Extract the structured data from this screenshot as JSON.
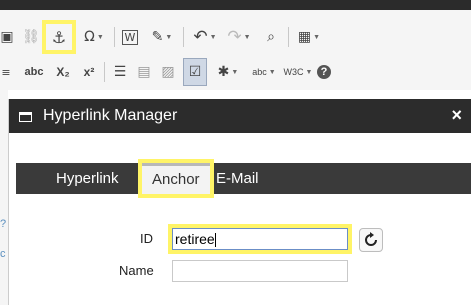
{
  "toolbar": {
    "row1": [
      {
        "icon": "paste-icon",
        "glyph": "▣"
      },
      {
        "icon": "link-icon",
        "glyph": "⛓"
      },
      {
        "icon": "anchor-insert-icon",
        "glyph": "⚓",
        "highlighted": true
      },
      {
        "icon": "special-character-icon",
        "glyph": "Ω"
      },
      {
        "icon": "paste-from-word-icon",
        "glyph": "W"
      },
      {
        "icon": "format-stripper-icon",
        "glyph": "✎"
      },
      {
        "icon": "undo-icon",
        "glyph": "↶"
      },
      {
        "icon": "redo-icon",
        "glyph": "↷"
      },
      {
        "icon": "find-replace-icon",
        "glyph": "⌕"
      },
      {
        "icon": "table-icon",
        "glyph": "▦"
      }
    ],
    "row2": [
      {
        "icon": "strikethrough-icon",
        "glyph": "abc"
      },
      {
        "icon": "subscript-icon",
        "glyph": "X₂"
      },
      {
        "icon": "superscript-icon",
        "glyph": "x²"
      },
      {
        "icon": "horizontal-rule-icon",
        "glyph": "☰"
      },
      {
        "icon": "insert-table-icon",
        "glyph": "▤"
      },
      {
        "icon": "image-icon",
        "glyph": "▨"
      },
      {
        "icon": "form-icon",
        "glyph": "☑",
        "selected": true
      },
      {
        "icon": "flash-icon",
        "glyph": "✱"
      },
      {
        "icon": "spellcheck-icon",
        "glyph": "abc✓"
      },
      {
        "icon": "html-validate-icon",
        "glyph": "W3C"
      },
      {
        "icon": "help-icon",
        "glyph": "?"
      }
    ]
  },
  "dialog": {
    "title": "Hyperlink Manager",
    "close": "×",
    "tabs": [
      "Hyperlink",
      "Anchor",
      "E-Mail"
    ],
    "fields": {
      "id_label": "ID",
      "id_value": "retiree",
      "name_label": "Name",
      "name_value": ""
    }
  },
  "colors": {
    "highlight": "#fff467",
    "header_bg": "#2c2c2c",
    "tabbar_bg": "#3a3a3a"
  }
}
